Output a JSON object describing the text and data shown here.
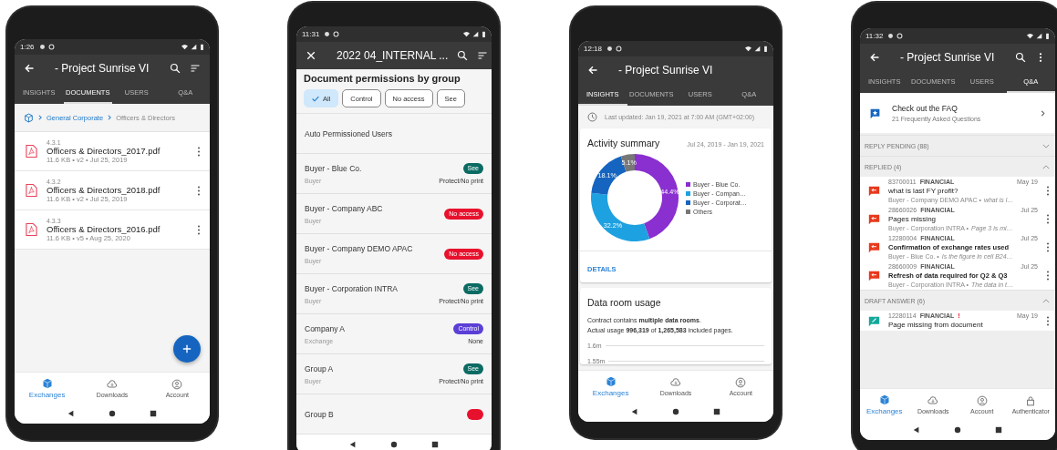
{
  "phones": [
    {
      "kind": "documents",
      "status_time": "1:26",
      "app_bar": {
        "title": "- Project Sunrise VI"
      },
      "tabs": [
        {
          "label": "INSIGHTS",
          "selected": false
        },
        {
          "label": "DOCUMENTS",
          "selected": true
        },
        {
          "label": "USERS",
          "selected": false
        },
        {
          "label": "Q&A",
          "selected": false
        }
      ],
      "breadcrumb": [
        "General Corporate",
        "Officers & Directors"
      ],
      "files": [
        {
          "index": "4.3.1",
          "name": "Officers & Directors_2017.pdf",
          "meta": "11.6 KB • v2 • Jul 25, 2019"
        },
        {
          "index": "4.3.2",
          "name": "Officers & Directors_2018.pdf",
          "meta": "11.6 KB • v2 • Jul 25, 2019"
        },
        {
          "index": "4.3.3",
          "name": "Officers & Directors_2016.pdf",
          "meta": "11.6 KB • v5 • Aug 25, 2020"
        }
      ],
      "bottom_nav": [
        {
          "label": "Exchanges",
          "selected": true
        },
        {
          "label": "Downloads",
          "selected": false
        },
        {
          "label": "Account",
          "selected": false
        }
      ]
    },
    {
      "kind": "permissions",
      "status_time": "11:31",
      "app_bar": {
        "title": "2022 04_INTERNAL ..."
      },
      "heading": "Document permissions by group",
      "filters": [
        {
          "label": "All",
          "selected": true
        },
        {
          "label": "Control",
          "selected": false
        },
        {
          "label": "No access",
          "selected": false
        },
        {
          "label": "See",
          "selected": false
        }
      ],
      "groups": [
        {
          "name": "Auto Permissioned Users"
        },
        {
          "name": "Buyer - Blue Co.",
          "role": "Buyer",
          "permission": {
            "kind": "see",
            "label": "See"
          },
          "restriction": "Protect/No print"
        },
        {
          "name": "Buyer - Company ABC",
          "role": "Buyer",
          "permission": {
            "kind": "no_access",
            "label": "No access"
          }
        },
        {
          "name": "Buyer - Company DEMO APAC",
          "role": "Buyer",
          "permission": {
            "kind": "no_access",
            "label": "No access"
          }
        },
        {
          "name": "Buyer - Corporation INTRA",
          "role": "Buyer",
          "permission": {
            "kind": "see",
            "label": "See"
          },
          "restriction": "Protect/No print"
        },
        {
          "name": "Company A",
          "role": "Exchange",
          "permission": {
            "kind": "control",
            "label": "Control"
          },
          "restriction": "None"
        },
        {
          "name": "Group A",
          "role": "Buyer",
          "permission": {
            "kind": "see",
            "label": "See"
          },
          "restriction": "Protect/No print"
        },
        {
          "name": "Group B",
          "permission": {
            "kind": "no_access"
          }
        }
      ]
    },
    {
      "kind": "insights",
      "status_time": "12:18",
      "app_bar": {
        "title": "- Project Sunrise VI"
      },
      "tabs": [
        {
          "label": "INSIGHTS",
          "selected": true
        },
        {
          "label": "DOCUMENTS",
          "selected": false
        },
        {
          "label": "USERS",
          "selected": false
        },
        {
          "label": "Q&A",
          "selected": false
        }
      ],
      "last_updated": "Last updated: Jan 19, 2021 at 7:00 AM (GMT+02:00)",
      "activity": {
        "title": "Activity summary",
        "range": "Jul 24, 2019 - Jan 19, 2021",
        "link": "DETAILS",
        "chart_data": {
          "type": "donut",
          "categories": [
            "Buyer - Blue Co.",
            "Buyer - Compan…",
            "Buyer - Corporat…",
            "Others"
          ],
          "values": [
            44.4,
            32.2,
            18.1,
            5.1
          ],
          "colors": [
            "#8a2fd0",
            "#1ea1e0",
            "#1565c0",
            "#777777"
          ],
          "value_labels": [
            "44.4%",
            "32.2%",
            "18.1%",
            "5.1%"
          ],
          "legend": "right"
        }
      },
      "usage": {
        "title": "Data room usage",
        "lines": [
          "Contract contains **multiple data rooms**.",
          "Actual usage **996,319** of **1,265,583** included pages."
        ],
        "axis_labels": [
          "1.6m",
          "1.55m"
        ]
      },
      "bottom_nav": [
        {
          "label": "Exchanges",
          "selected": true
        },
        {
          "label": "Downloads",
          "selected": false
        },
        {
          "label": "Account",
          "selected": false
        }
      ]
    },
    {
      "kind": "qa",
      "status_time": "11:32",
      "app_bar": {
        "title": "- Project Sunrise VI"
      },
      "tabs": [
        {
          "label": "INSIGHTS",
          "selected": false
        },
        {
          "label": "DOCUMENTS",
          "selected": false
        },
        {
          "label": "USERS",
          "selected": false
        },
        {
          "label": "Q&A",
          "selected": true
        }
      ],
      "faq": {
        "title": "Check out the FAQ",
        "subtitle": "21 Frequently Asked Questions"
      },
      "sections": [
        {
          "label": "REPLY PENDING (88)",
          "expanded": false
        },
        {
          "label": "REPLIED (4)",
          "expanded": true,
          "items": [
            {
              "kind": "replied",
              "id": "83700011",
              "category": "FINANCIAL",
              "date": "May 19",
              "title": "what is last FY profit?",
              "unread": false,
              "author": "Buyer - Company DEMO APAC •",
              "excerpt": "what is l…"
            },
            {
              "kind": "replied",
              "id": "28660026",
              "category": "FINANCIAL",
              "date": "Jul 25",
              "title": "Pages missing",
              "unread": false,
              "author": "Buyer - Corporation INTRA •",
              "excerpt": "Page 3 is mi…"
            },
            {
              "kind": "replied",
              "id": "12280004",
              "category": "FINANCIAL",
              "date": "Jul 25",
              "title": "Confirmation of exchange rates used",
              "unread": true,
              "author": "Buyer - Blue Co. •",
              "excerpt": "Is the figure in cell B24…"
            },
            {
              "kind": "replied",
              "id": "28660009",
              "category": "FINANCIAL",
              "date": "Jul 25",
              "title": "Refresh of data required for Q2 & Q3",
              "unread": true,
              "author": "Buyer - Corporation INTRA •",
              "excerpt": "The data in t…"
            }
          ]
        },
        {
          "label": "DRAFT ANSWER (6)",
          "expanded": true,
          "items": [
            {
              "kind": "draft",
              "id": "12280114",
              "category": "FINANCIAL",
              "flag": "!",
              "date": "May 19",
              "title": "Page missing from document",
              "unread": false
            }
          ]
        }
      ],
      "bottom_nav": [
        {
          "label": "Exchanges",
          "selected": true
        },
        {
          "label": "Downloads",
          "selected": false
        },
        {
          "label": "Account",
          "selected": false
        },
        {
          "label": "Authenticator",
          "selected": false
        }
      ]
    }
  ]
}
